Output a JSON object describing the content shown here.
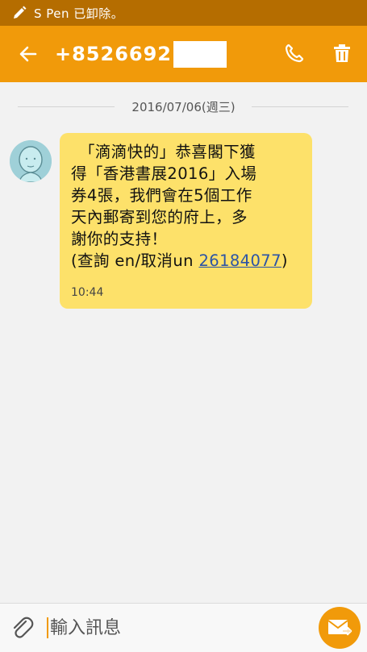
{
  "status_bar": {
    "text": "S Pen 已卸除。",
    "icon": "pen-icon"
  },
  "header": {
    "phone_number": "+8526692",
    "back_icon": "back-arrow-icon",
    "call_icon": "phone-icon",
    "delete_icon": "trash-icon",
    "background_color": "#f19a0a"
  },
  "conversation": {
    "date": "2016/07/06(週三)",
    "message": {
      "lines": [
        "「滴滴快的」恭喜閣下獲",
        "得「香港書展2016」入場",
        "券4張，我們會在5個工作",
        "天內郵寄到您的府上，多",
        "謝你的支持！"
      ],
      "last_line_prefix": "(查詢 en/取消un ",
      "link": "26184077",
      "last_line_suffix": ")",
      "time": "10:44",
      "bubble_color": "#fde16a"
    }
  },
  "composer": {
    "placeholder": "輸入訊息",
    "attach_icon": "paperclip-icon",
    "send_icon": "send-mail-icon"
  }
}
